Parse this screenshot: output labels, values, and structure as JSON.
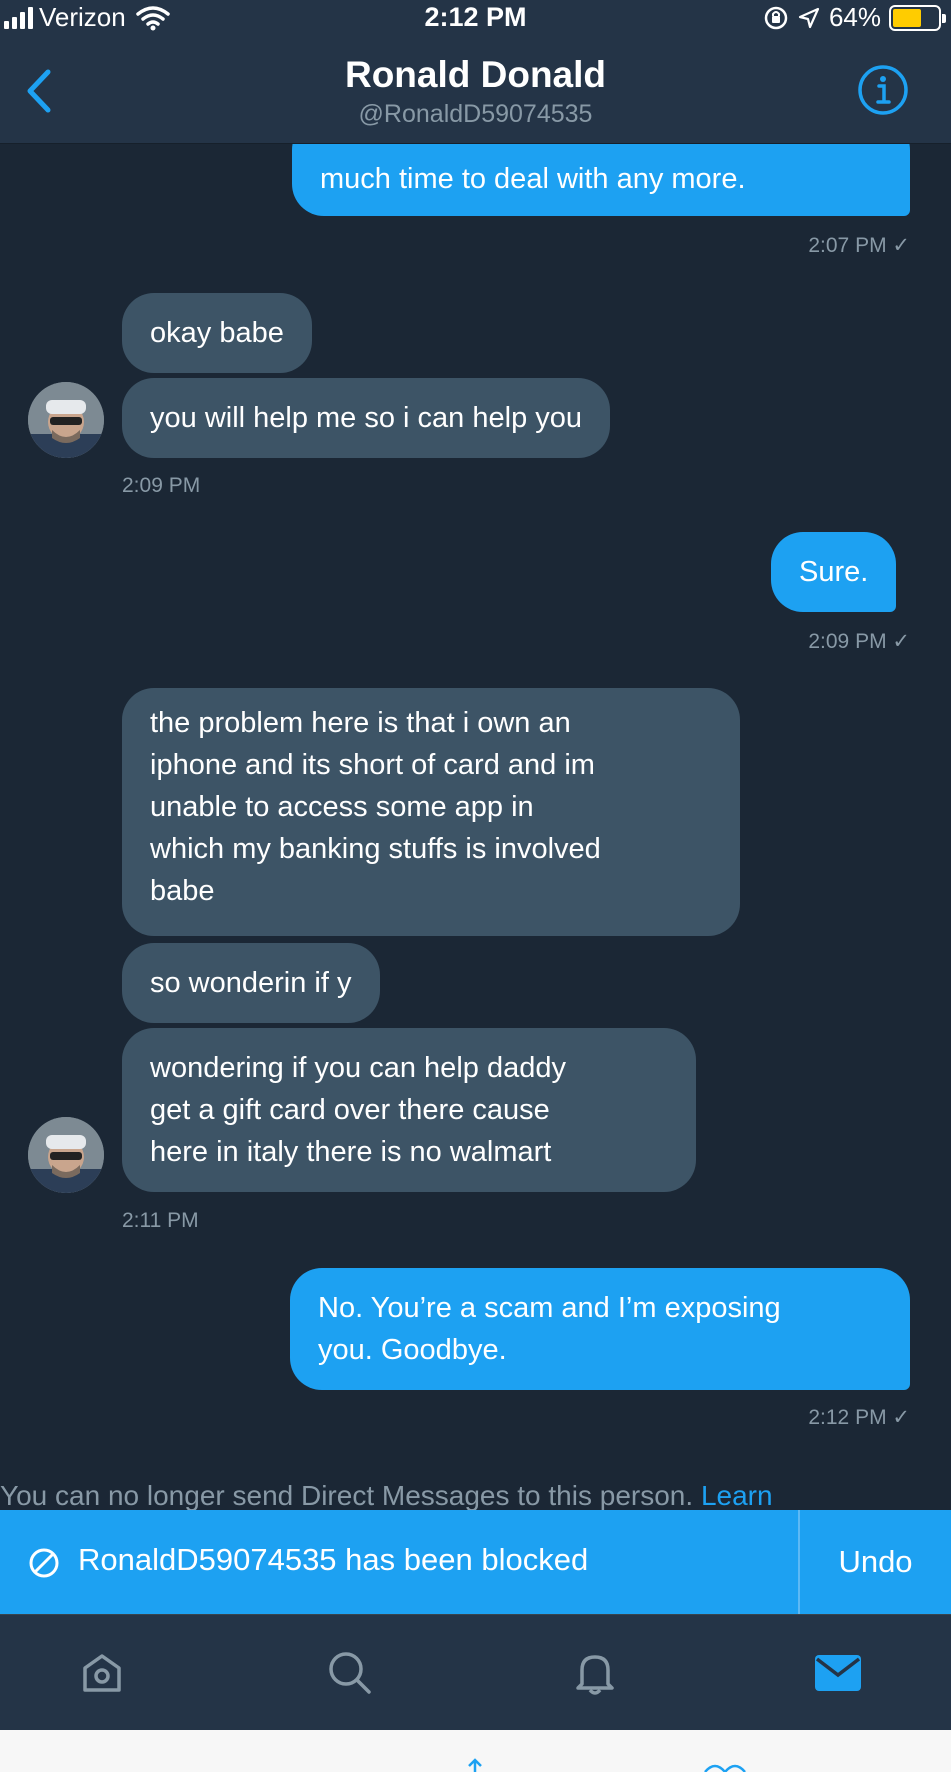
{
  "status_bar": {
    "carrier": "Verizon",
    "time": "2:12 PM",
    "battery": "64%",
    "battery_level": 0.64,
    "icons": [
      "signal-icon",
      "wifi-icon",
      "orientation-lock-icon",
      "location-icon",
      "battery-icon"
    ]
  },
  "header": {
    "name": "Ronald Donald",
    "handle": "@RonaldD59074535",
    "icons": [
      "back-chevron-icon",
      "info-icon"
    ]
  },
  "messages": [
    {
      "text": "much time to deal with any more."
    },
    {
      "text": "2:07 PM ✓"
    },
    {
      "text": "okay babe"
    },
    {
      "text": "you will help me so i can help you"
    },
    {
      "text": "2:09 PM"
    },
    {
      "text": "Sure."
    },
    {
      "text": "2:09 PM ✓"
    },
    {
      "lines": [
        "the problem here is that i own an",
        "iphone and its short of card and im",
        "unable to access some app in",
        "which my banking stuffs is involved",
        "babe"
      ]
    },
    {
      "text": "so wonderin if y"
    },
    {
      "lines": [
        "wondering if you can help daddy",
        "get a gift card over there cause",
        "here in italy there is no walmart"
      ]
    },
    {
      "text": "2:11 PM"
    },
    {
      "lines": [
        "No. You’re a scam and I’m exposing",
        "you. Goodbye."
      ]
    },
    {
      "text": "2:12 PM ✓"
    }
  ],
  "notice": {
    "text": "You can no longer send Direct Messages to this person.",
    "link": "Learn"
  },
  "banner": {
    "text": "RonaldD59074535 has been blocked",
    "undo": "Undo",
    "color": "#1da1f2"
  },
  "tabbar": {
    "icons": [
      "home-icon",
      "search-icon",
      "notifications-icon",
      "messages-icon"
    ],
    "active_color": "#1da1f2"
  },
  "colors": {
    "background": "#1b2735",
    "header": "#243447",
    "incoming_bubble": "#3d5466",
    "outgoing_bubble": "#1da1f2"
  }
}
